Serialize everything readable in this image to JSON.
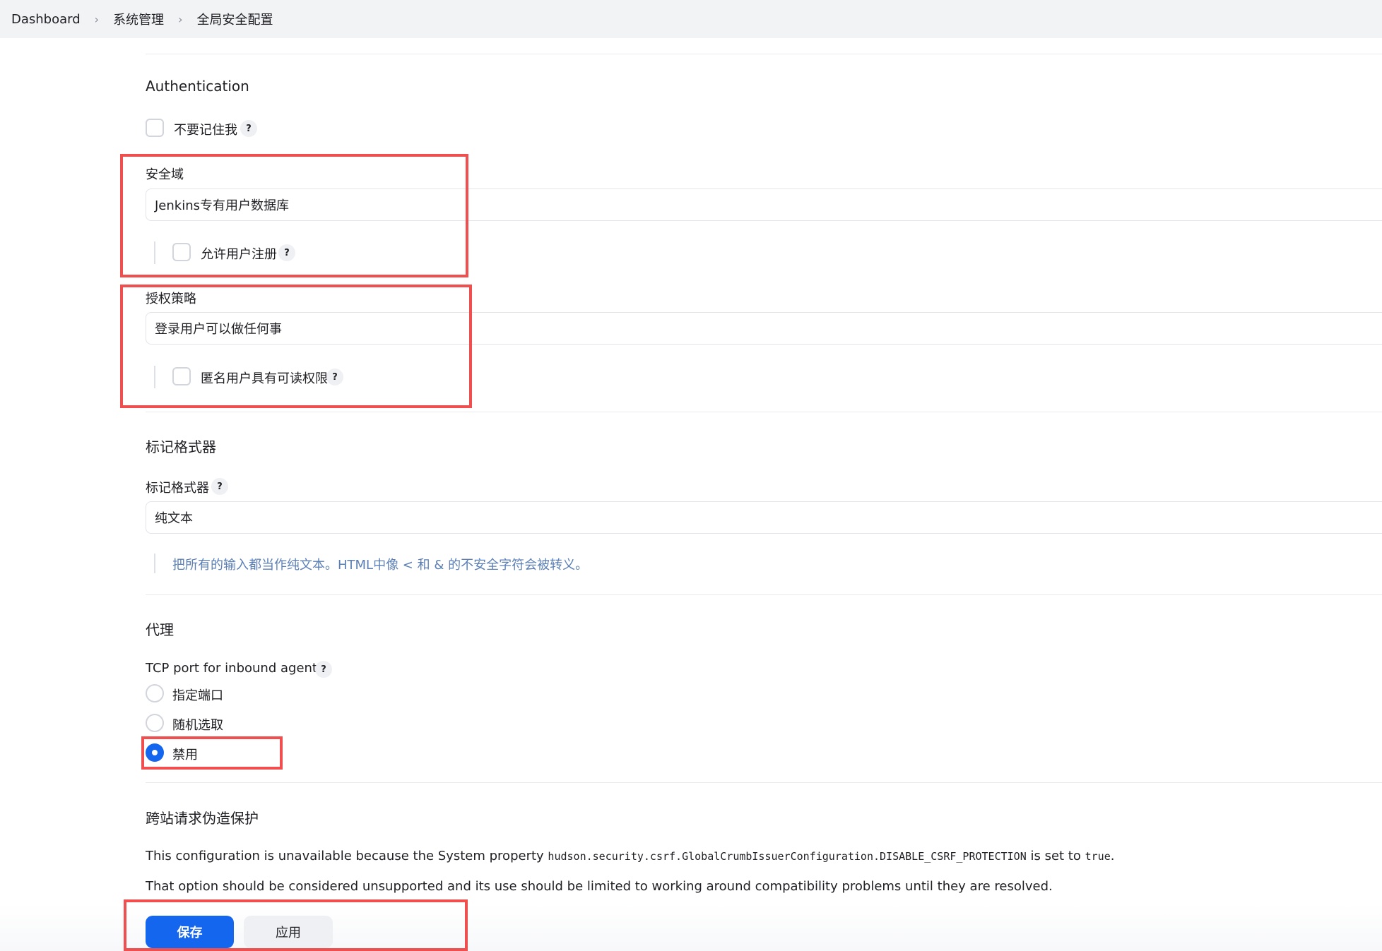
{
  "breadcrumb": {
    "items": [
      "Dashboard",
      "系统管理",
      "全局安全配置"
    ]
  },
  "authentication": {
    "title": "Authentication",
    "remember_me_label": "不要记住我"
  },
  "security_realm": {
    "label": "安全域",
    "value": "Jenkins专有用户数据库",
    "allow_signup_label": "允许用户注册"
  },
  "authorization": {
    "label": "授权策略",
    "value": "登录用户可以做任何事",
    "anonymous_read_label": "匿名用户具有可读权限"
  },
  "markup_formatter": {
    "title": "标记格式器",
    "label": "标记格式器",
    "value": "纯文本",
    "description": "把所有的输入都当作纯文本。HTML中像 < 和 & 的不安全字符会被转义。"
  },
  "agents": {
    "title": "代理",
    "tcp_port_label": "TCP port for inbound agents",
    "options": [
      "指定端口",
      "随机选取",
      "禁用"
    ],
    "selected": "禁用"
  },
  "csrf": {
    "title": "跨站请求伪造保护",
    "line1_prefix": "This configuration is unavailable because the System property",
    "line1_property": "hudson.security.csrf.GlobalCrumbIssuerConfiguration.DISABLE_CSRF_PROTECTION",
    "line1_mid": "is set to",
    "line1_value": "true",
    "line1_end": ".",
    "line2": "That option should be considered unsupported and its use should be limited to working around compatibility problems until they are resolved."
  },
  "actions": {
    "save_label": "保存",
    "apply_label": "应用"
  },
  "help_glyph": "?",
  "breadcrumb_separator": "›",
  "colors": {
    "accent": "#1466ef",
    "highlight": "#ef4f4f",
    "hint": "#5b7fb5"
  }
}
